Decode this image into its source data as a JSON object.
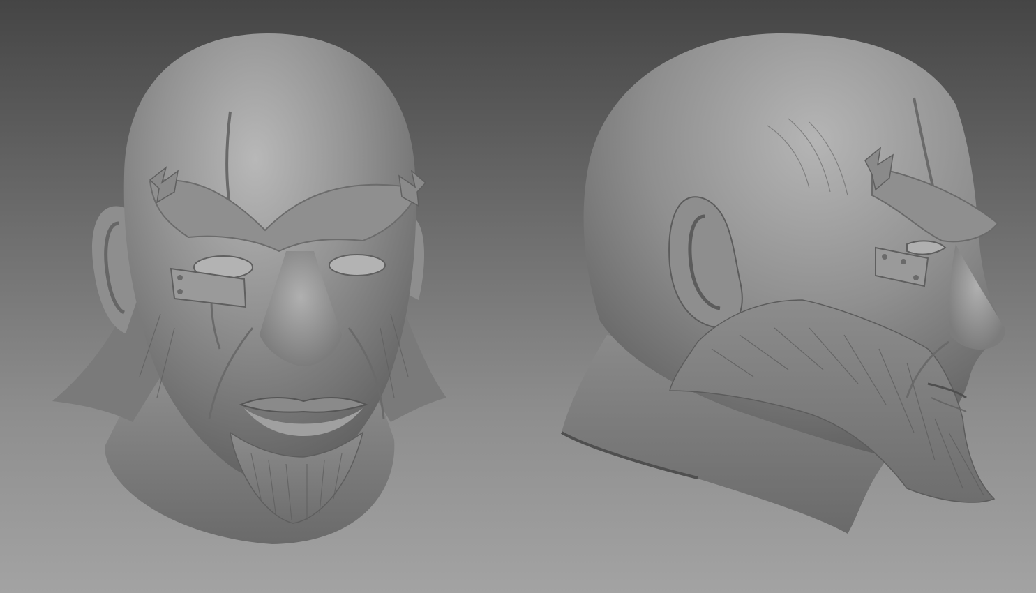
{
  "viewport": {
    "background_top": "#454545",
    "background_bottom": "#a3a3a3"
  },
  "models": [
    {
      "view": "front",
      "material": "clay-gray",
      "color": "#8a8a8a"
    },
    {
      "view": "right-profile",
      "material": "clay-gray",
      "color": "#8a8a8a"
    }
  ]
}
